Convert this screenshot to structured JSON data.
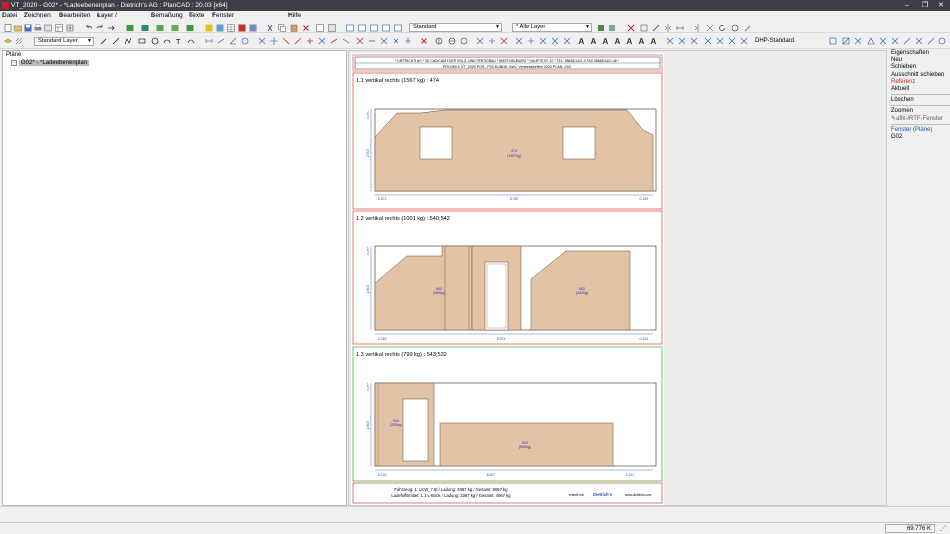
{
  "window": {
    "title": "VT_2020 - G02* - *Ladeebenenplan - Dietrich's AG : PlanCAD : 20.03 [x64]"
  },
  "menu": [
    {
      "key": "1",
      "label": "Datei"
    },
    {
      "key": "2",
      "label": "Zeichnen"
    },
    {
      "key": "3",
      "label": "Bearbeiten"
    },
    {
      "key": "4",
      "label": "Layer / Gruppen"
    },
    {
      "key": "5",
      "label": "Bemaßung"
    },
    {
      "key": "6",
      "label": "Texte"
    },
    {
      "key": "7",
      "label": "Fenster"
    },
    {
      "key": "?",
      "label": "Hilfe"
    }
  ],
  "toolbar": {
    "style_select": "Standard",
    "layer_filter": "* Alle Layer",
    "current_layer": "Standard Layer",
    "dim_style": "DHP-Standard"
  },
  "tree": {
    "root": "Pläne",
    "child": "G02* - *Ladeebenenplan"
  },
  "sheet": {
    "header_line1": "* DIETRICH'S AG * 3D CAD/CAM FUER HOLZ- UND FERTIGBAU * 85579 NEUBURG * HAUPTSTR. 57 * TEL. 08645/1421-0 FAX 08645/1421-46 *",
    "header_line2": "PROJEKT: VT_2020   POS.: P03   KUNDE:   Bvh.: Vertriebstreffen 2020   PLAN: G02",
    "panels": [
      {
        "title": "1.1 vertikal rechts (1567 kg) :  474",
        "dims": [
          "0.071",
          "5.780",
          "0.149"
        ],
        "height": "2.500",
        "top_dim": "0.071",
        "pieces": [
          {
            "id": "474",
            "weight": "(1567kg)"
          }
        ]
      },
      {
        "title": "1.2 vertikal rechts (1001 kg) :  540;542",
        "dims": [
          "0.062",
          "8.974",
          "0.944"
        ],
        "height": "2.600",
        "top_dim": "0.077",
        "pieces": [
          {
            "id": "540",
            "weight": "(559kg)"
          },
          {
            "id": "542",
            "weight": "(442kg)"
          }
        ]
      },
      {
        "title": "1.3 vertikal rechts (799 kg) :  543;532",
        "dims": [
          "0.102",
          "8.507",
          "1.021"
        ],
        "height": "2.600",
        "top_dim": "0.077",
        "pieces": [
          {
            "id": "543",
            "weight": "(209kg)"
          },
          {
            "id": "532",
            "weight": "(590kg)"
          }
        ]
      }
    ],
    "footer_line1": "Fahrzeug: 1. LKW_7.5t / Ladung: 4067 kg / Gesamt: 8067 kg",
    "footer_line2": "Ladehilfsmittel: 1.1 L-Bock / Ladung: 3367 kg / Gesamt: 4067 kg",
    "footer_small": "erstellt mit:",
    "brand": "Dietrich's",
    "brand_url": "www.dietrichs.com"
  },
  "side_menu": {
    "items": [
      "Eigenschaften",
      "Neu",
      "Schieben",
      "Ausschnitt schieben",
      "Referenz",
      "Aktuell",
      "Löschen",
      "Zoomen",
      "afik-/RTF-Fenster",
      "Fenster (Pläne)",
      "G02"
    ],
    "highlight_color": "#d02020"
  },
  "status": {
    "coordinate": "69.776 K"
  }
}
